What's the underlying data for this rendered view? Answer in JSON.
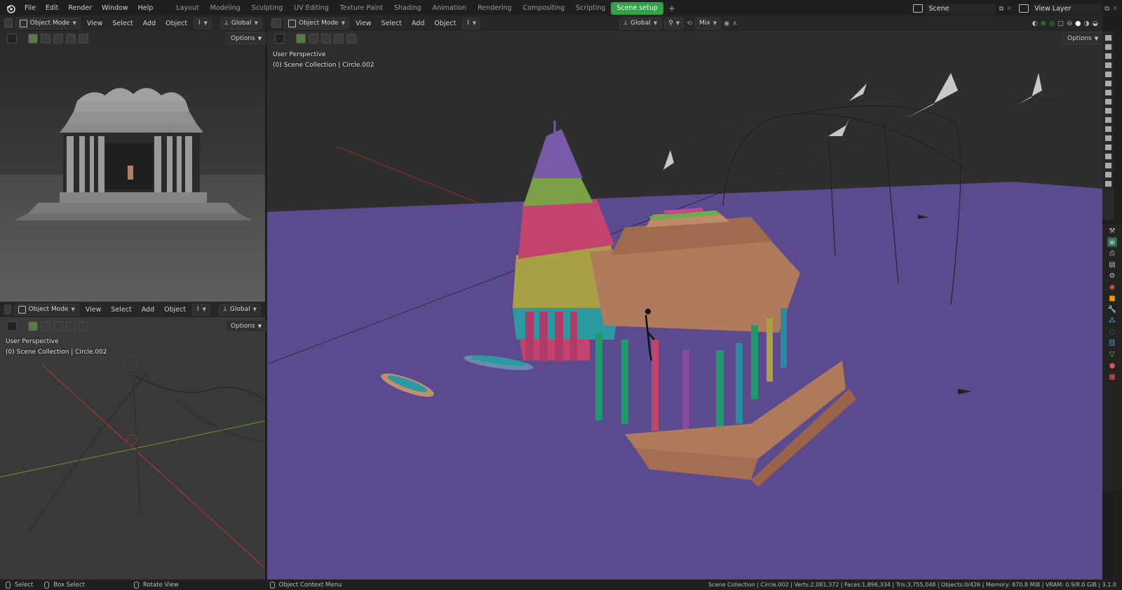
{
  "menubar": {
    "items": [
      "File",
      "Edit",
      "Render",
      "Window",
      "Help"
    ]
  },
  "workspaces": {
    "tabs": [
      "Layout",
      "Modeling",
      "Sculpting",
      "UV Editing",
      "Texture Paint",
      "Shading",
      "Animation",
      "Rendering",
      "Compositing",
      "Scripting",
      "Scene setup"
    ],
    "active": "Scene setup",
    "add_label": "+"
  },
  "scene": {
    "name": "Scene",
    "view_layer": "View Layer"
  },
  "viewport_header": {
    "mode": "Object Mode",
    "menus": [
      "View",
      "Select",
      "Add",
      "Object"
    ],
    "orientation": "Global",
    "pivot": "Mix",
    "options": "Options"
  },
  "viewports": {
    "main": {
      "perspective": "User Perspective",
      "collection": "(0) Scene Collection | Circle.002"
    },
    "bottom_left": {
      "perspective": "User Perspective",
      "collection": "(0) Scene Collection | Circle.002"
    }
  },
  "statusbar": {
    "select": "Select",
    "box_select": "Box Select",
    "rotate_view": "Rotate View",
    "context_menu": "Object Context Menu",
    "stats": "Scene Collection | Circle.002 | Verts:2,081,372 | Faces:1,896,334 | Tris:3,755,048 | Objects:0/426 | Memory: 870.8 MiB | VRAM: 0.9/8.0 GiB | 3.1.0"
  },
  "colors": {
    "accent": "#33a04a",
    "floor": "#5b4a8e",
    "temple_base": "#b07a5c",
    "pillar_green": "#1f9a6e",
    "shikhara_pink": "#c2446e",
    "shikhara_purple": "#7a5aa8",
    "shikhara_yellow": "#a9a046",
    "teal": "#2a9aa0"
  }
}
